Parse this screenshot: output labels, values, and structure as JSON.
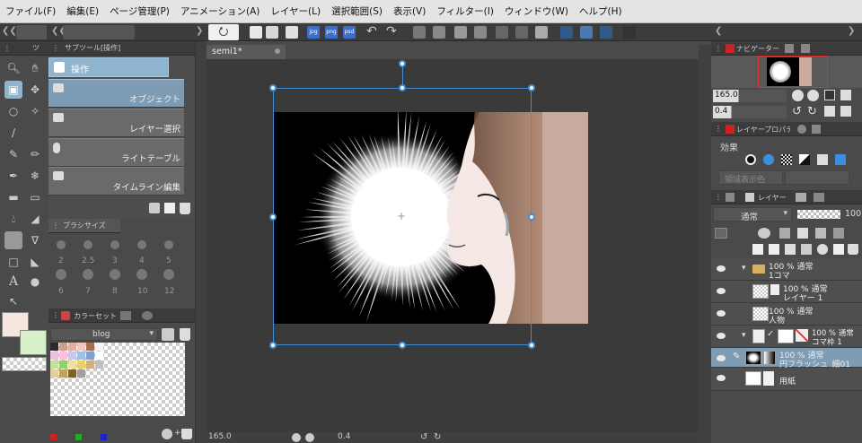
{
  "menu": [
    "ファイル(F)",
    "編集(E)",
    "ページ管理(P)",
    "アニメーション(A)",
    "レイヤー(L)",
    "選択範囲(S)",
    "表示(V)",
    "フィルター(I)",
    "ウィンドウ(W)",
    "ヘルプ(H)"
  ],
  "tool_panel_header": "ツ",
  "subtool_header": "サブツール[操作]",
  "subtool_active": "操作",
  "subtools": [
    "オブジェクト",
    "レイヤー選択",
    "ライトテーブル",
    "タイムライン編集"
  ],
  "brush_size_header": "ブラシサイズ",
  "brush_sizes": [
    "2",
    "2.5",
    "3",
    "4",
    "5",
    "6",
    "7",
    "8",
    "10",
    "12"
  ],
  "color_set_header": "カラーセット",
  "color_set_name": "blog",
  "canvas_tab": "semi1*",
  "status_zoom": "165.0",
  "status_rotation": "0.4",
  "navigator_tab": "ナビゲーター",
  "nav_zoom": "165.0",
  "nav_rotation": "0.4",
  "layer_property_tab": "レイヤープロパティ",
  "effect_label": "効果",
  "area_label": "領域表示色",
  "layer_tab": "レイヤー",
  "blend_mode": "通常",
  "opacity": "100",
  "layers": [
    {
      "line1": "100 % 通常",
      "line2": "1コマ"
    },
    {
      "line1": "100 % 通常",
      "line2": "レイヤー 1"
    },
    {
      "line1": "100 % 通常",
      "line2": "人物"
    },
    {
      "line1": "100 % 通常",
      "line2": "コマ枠 1"
    },
    {
      "line1": "100 % 通常",
      "line2": "円フラッシュ_細01"
    },
    {
      "line1": "",
      "line2": "用紙"
    }
  ],
  "palette": [
    "#2b2b2b",
    "#c8a090",
    "#e0b0a0",
    "#f0c8c0",
    "#a07050",
    "#f4f4f4",
    "#e8c0e0",
    "#ffc0e0",
    "#c8c8f0",
    "#a0c0e0",
    "#80a0d0",
    "#ffffff",
    "#c0e0a0",
    "#90d070",
    "#f0e0a0",
    "#e8d070",
    "#d0b080",
    "#c0c0c0",
    "#e0d0a0",
    "#c0a060",
    "#806030",
    "#a0a0a0"
  ]
}
